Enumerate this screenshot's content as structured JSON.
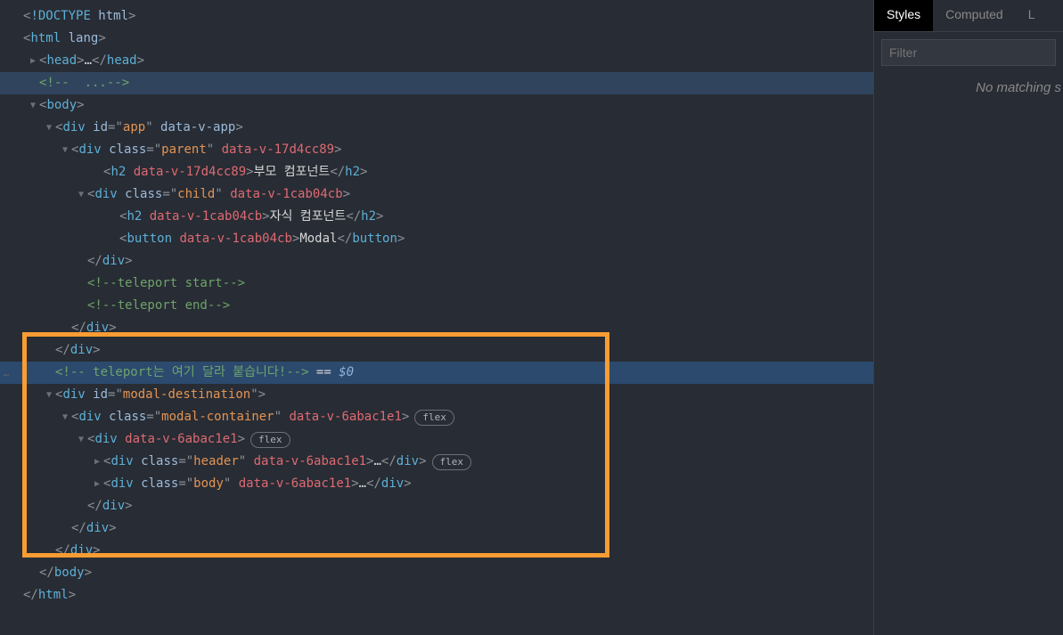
{
  "tabs": {
    "styles": "Styles",
    "computed": "Computed",
    "overflow": "L"
  },
  "filter": {
    "placeholder": "Filter"
  },
  "noMatch": "No matching s",
  "badges": {
    "flex": "flex"
  },
  "suffix": {
    "eq0": " == $0"
  },
  "arrows": {
    "right": "▶",
    "down": "▼"
  },
  "lines": [
    {
      "ind": 0,
      "arrow": "",
      "tokens": [
        {
          "t": "<",
          "c": "p-gray"
        },
        {
          "t": "!DOCTYPE ",
          "c": "tag"
        },
        {
          "t": "html",
          "c": "attr"
        },
        {
          "t": ">",
          "c": "p-gray"
        }
      ]
    },
    {
      "ind": 0,
      "arrow": "",
      "tokens": [
        {
          "t": "<",
          "c": "p-gray"
        },
        {
          "t": "html",
          "c": "tag"
        },
        {
          "t": " lang",
          "c": "attr"
        },
        {
          "t": ">",
          "c": "p-gray"
        }
      ]
    },
    {
      "ind": 1,
      "arrow": "right",
      "tokens": [
        {
          "t": "<",
          "c": "p-gray"
        },
        {
          "t": "head",
          "c": "tag"
        },
        {
          "t": ">",
          "c": "p-gray"
        },
        {
          "t": "…",
          "c": "txt"
        },
        {
          "t": "</",
          "c": "p-gray"
        },
        {
          "t": "head",
          "c": "tag"
        },
        {
          "t": ">",
          "c": "p-gray"
        }
      ]
    },
    {
      "ind": 1,
      "arrow": "",
      "highlighted": true,
      "tokens": [
        {
          "t": "<!--  ...-->",
          "c": "comment"
        }
      ]
    },
    {
      "ind": 1,
      "arrow": "down",
      "tokens": [
        {
          "t": "<",
          "c": "p-gray"
        },
        {
          "t": "body",
          "c": "tag"
        },
        {
          "t": ">",
          "c": "p-gray"
        }
      ]
    },
    {
      "ind": 2,
      "arrow": "down",
      "tokens": [
        {
          "t": "<",
          "c": "p-gray"
        },
        {
          "t": "div",
          "c": "tag"
        },
        {
          "t": " id",
          "c": "attr"
        },
        {
          "t": "=\"",
          "c": "p-gray"
        },
        {
          "t": "app",
          "c": "str"
        },
        {
          "t": "\"",
          "c": "p-gray"
        },
        {
          "t": " data-v-app",
          "c": "attr"
        },
        {
          "t": ">",
          "c": "p-gray"
        }
      ]
    },
    {
      "ind": 3,
      "arrow": "down",
      "tokens": [
        {
          "t": "<",
          "c": "p-gray"
        },
        {
          "t": "div",
          "c": "tag"
        },
        {
          "t": " class",
          "c": "attr"
        },
        {
          "t": "=\"",
          "c": "p-gray"
        },
        {
          "t": "parent",
          "c": "str"
        },
        {
          "t": "\"",
          "c": "p-gray"
        },
        {
          "t": " data-v-17d4cc89",
          "c": "attr-red"
        },
        {
          "t": ">",
          "c": "p-gray"
        }
      ]
    },
    {
      "ind": 5,
      "arrow": "",
      "tokens": [
        {
          "t": "<",
          "c": "p-gray"
        },
        {
          "t": "h2",
          "c": "tag"
        },
        {
          "t": " data-v-17d4cc89",
          "c": "attr-red"
        },
        {
          "t": ">",
          "c": "p-gray"
        },
        {
          "t": "부모 컴포넌트",
          "c": "txt"
        },
        {
          "t": "</",
          "c": "p-gray"
        },
        {
          "t": "h2",
          "c": "tag"
        },
        {
          "t": ">",
          "c": "p-gray"
        }
      ]
    },
    {
      "ind": 4,
      "arrow": "down",
      "tokens": [
        {
          "t": "<",
          "c": "p-gray"
        },
        {
          "t": "div",
          "c": "tag"
        },
        {
          "t": " class",
          "c": "attr"
        },
        {
          "t": "=\"",
          "c": "p-gray"
        },
        {
          "t": "child",
          "c": "str"
        },
        {
          "t": "\"",
          "c": "p-gray"
        },
        {
          "t": " data-v-1cab04cb",
          "c": "attr-red"
        },
        {
          "t": ">",
          "c": "p-gray"
        }
      ]
    },
    {
      "ind": 6,
      "arrow": "",
      "tokens": [
        {
          "t": "<",
          "c": "p-gray"
        },
        {
          "t": "h2",
          "c": "tag"
        },
        {
          "t": " data-v-1cab04cb",
          "c": "attr-red"
        },
        {
          "t": ">",
          "c": "p-gray"
        },
        {
          "t": "자식 컴포넌트",
          "c": "txt"
        },
        {
          "t": "</",
          "c": "p-gray"
        },
        {
          "t": "h2",
          "c": "tag"
        },
        {
          "t": ">",
          "c": "p-gray"
        }
      ]
    },
    {
      "ind": 6,
      "arrow": "",
      "tokens": [
        {
          "t": "<",
          "c": "p-gray"
        },
        {
          "t": "button",
          "c": "tag"
        },
        {
          "t": " data-v-1cab04cb",
          "c": "attr-red"
        },
        {
          "t": ">",
          "c": "p-gray"
        },
        {
          "t": "Modal",
          "c": "txt"
        },
        {
          "t": "</",
          "c": "p-gray"
        },
        {
          "t": "button",
          "c": "tag"
        },
        {
          "t": ">",
          "c": "p-gray"
        }
      ]
    },
    {
      "ind": 4,
      "arrow": "",
      "tokens": [
        {
          "t": "</",
          "c": "p-gray"
        },
        {
          "t": "div",
          "c": "tag"
        },
        {
          "t": ">",
          "c": "p-gray"
        }
      ]
    },
    {
      "ind": 4,
      "arrow": "",
      "tokens": [
        {
          "t": "<!--teleport start-->",
          "c": "comment"
        }
      ]
    },
    {
      "ind": 4,
      "arrow": "",
      "tokens": [
        {
          "t": "<!--teleport end-->",
          "c": "comment"
        }
      ]
    },
    {
      "ind": 3,
      "arrow": "",
      "tokens": [
        {
          "t": "</",
          "c": "p-gray"
        },
        {
          "t": "div",
          "c": "tag"
        },
        {
          "t": ">",
          "c": "p-gray"
        }
      ]
    },
    {
      "ind": 2,
      "arrow": "",
      "tokens": [
        {
          "t": "</",
          "c": "p-gray"
        },
        {
          "t": "div",
          "c": "tag"
        },
        {
          "t": ">",
          "c": "p-gray"
        }
      ]
    },
    {
      "ind": 2,
      "arrow": "",
      "selected": true,
      "dots": true,
      "tokens": [
        {
          "t": "<!-- teleport는 여기 달라 붙습니다!-->",
          "c": "comment"
        },
        {
          "t": " == ",
          "c": "txt"
        },
        {
          "t": "$0",
          "c": "sel0"
        }
      ]
    },
    {
      "ind": 2,
      "arrow": "down",
      "tokens": [
        {
          "t": "<",
          "c": "p-gray"
        },
        {
          "t": "div",
          "c": "tag"
        },
        {
          "t": " id",
          "c": "attr"
        },
        {
          "t": "=\"",
          "c": "p-gray"
        },
        {
          "t": "modal-destination",
          "c": "str"
        },
        {
          "t": "\"",
          "c": "p-gray"
        },
        {
          "t": ">",
          "c": "p-gray"
        }
      ]
    },
    {
      "ind": 3,
      "arrow": "down",
      "flex": true,
      "tokens": [
        {
          "t": "<",
          "c": "p-gray"
        },
        {
          "t": "div",
          "c": "tag"
        },
        {
          "t": " class",
          "c": "attr"
        },
        {
          "t": "=\"",
          "c": "p-gray"
        },
        {
          "t": "modal-container",
          "c": "str"
        },
        {
          "t": "\"",
          "c": "p-gray"
        },
        {
          "t": " data-v-6abac1e1",
          "c": "attr-red"
        },
        {
          "t": ">",
          "c": "p-gray"
        }
      ]
    },
    {
      "ind": 4,
      "arrow": "down",
      "flex": true,
      "tokens": [
        {
          "t": "<",
          "c": "p-gray"
        },
        {
          "t": "div",
          "c": "tag"
        },
        {
          "t": " data-v-6abac1e1",
          "c": "attr-red"
        },
        {
          "t": ">",
          "c": "p-gray"
        }
      ]
    },
    {
      "ind": 5,
      "arrow": "right",
      "flex": true,
      "tokens": [
        {
          "t": "<",
          "c": "p-gray"
        },
        {
          "t": "div",
          "c": "tag"
        },
        {
          "t": " class",
          "c": "attr"
        },
        {
          "t": "=\"",
          "c": "p-gray"
        },
        {
          "t": "header",
          "c": "str"
        },
        {
          "t": "\"",
          "c": "p-gray"
        },
        {
          "t": " data-v-6abac1e1",
          "c": "attr-red"
        },
        {
          "t": ">",
          "c": "p-gray"
        },
        {
          "t": "…",
          "c": "txt"
        },
        {
          "t": "</",
          "c": "p-gray"
        },
        {
          "t": "div",
          "c": "tag"
        },
        {
          "t": ">",
          "c": "p-gray"
        }
      ]
    },
    {
      "ind": 5,
      "arrow": "right",
      "tokens": [
        {
          "t": "<",
          "c": "p-gray"
        },
        {
          "t": "div",
          "c": "tag"
        },
        {
          "t": " class",
          "c": "attr"
        },
        {
          "t": "=\"",
          "c": "p-gray"
        },
        {
          "t": "body",
          "c": "str"
        },
        {
          "t": "\"",
          "c": "p-gray"
        },
        {
          "t": " data-v-6abac1e1",
          "c": "attr-red"
        },
        {
          "t": ">",
          "c": "p-gray"
        },
        {
          "t": "…",
          "c": "txt"
        },
        {
          "t": "</",
          "c": "p-gray"
        },
        {
          "t": "div",
          "c": "tag"
        },
        {
          "t": ">",
          "c": "p-gray"
        }
      ]
    },
    {
      "ind": 4,
      "arrow": "",
      "tokens": [
        {
          "t": "</",
          "c": "p-gray"
        },
        {
          "t": "div",
          "c": "tag"
        },
        {
          "t": ">",
          "c": "p-gray"
        }
      ]
    },
    {
      "ind": 3,
      "arrow": "",
      "tokens": [
        {
          "t": "</",
          "c": "p-gray"
        },
        {
          "t": "div",
          "c": "tag"
        },
        {
          "t": ">",
          "c": "p-gray"
        }
      ]
    },
    {
      "ind": 2,
      "arrow": "",
      "tokens": [
        {
          "t": "</",
          "c": "p-gray"
        },
        {
          "t": "div",
          "c": "tag"
        },
        {
          "t": ">",
          "c": "p-gray"
        }
      ]
    },
    {
      "ind": 1,
      "arrow": "",
      "tokens": [
        {
          "t": "</",
          "c": "p-gray"
        },
        {
          "t": "body",
          "c": "tag"
        },
        {
          "t": ">",
          "c": "p-gray"
        }
      ]
    },
    {
      "ind": 0,
      "arrow": "",
      "tokens": [
        {
          "t": "</",
          "c": "p-gray"
        },
        {
          "t": "html",
          "c": "tag"
        },
        {
          "t": ">",
          "c": "p-gray"
        }
      ]
    }
  ]
}
